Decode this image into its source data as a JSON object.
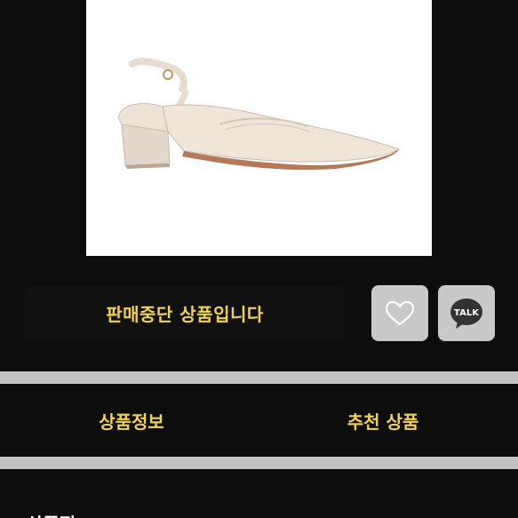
{
  "product": {
    "image_alt": "beige slingback block-heel pump"
  },
  "status": {
    "text": "판매중단 상품입니다"
  },
  "actions": {
    "heart_icon": "heart-icon",
    "talk_icon": "talk-icon",
    "talk_label": "TALK"
  },
  "tabs": [
    {
      "label": "상품정보"
    },
    {
      "label": "추천 상품"
    }
  ],
  "section": {
    "heading": "상품정"
  },
  "colors": {
    "accent_text": "#f2d250",
    "background": "#0d0d0d",
    "button_gray": "#c9c9c9",
    "divider_gray": "#c2c2c2"
  }
}
